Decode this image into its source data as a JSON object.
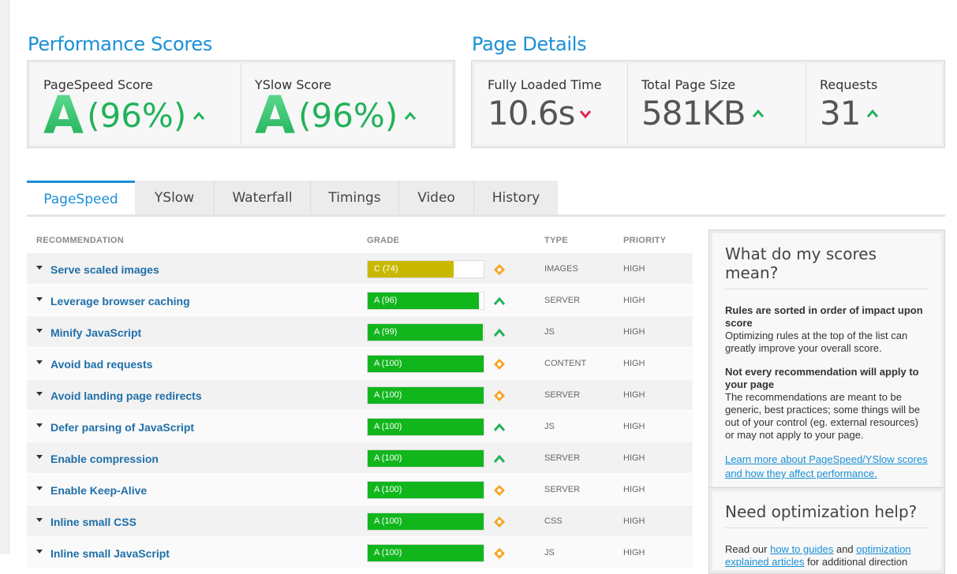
{
  "header": {
    "clipped_caption": "..."
  },
  "performance": {
    "title": "Performance Scores",
    "pagespeed": {
      "label": "PageSpeed Score",
      "grade": "A",
      "percent": "(96%)",
      "trend": "up"
    },
    "yslow": {
      "label": "YSlow Score",
      "grade": "A",
      "percent": "(96%)",
      "trend": "up"
    }
  },
  "details": {
    "title": "Page Details",
    "load_time": {
      "label": "Fully Loaded Time",
      "value": "10.6s",
      "trend": "down"
    },
    "page_size": {
      "label": "Total Page Size",
      "value": "581KB",
      "trend": "up"
    },
    "requests": {
      "label": "Requests",
      "value": "31",
      "trend": "up"
    }
  },
  "tabs": [
    {
      "label": "PageSpeed",
      "active": true
    },
    {
      "label": "YSlow",
      "active": false
    },
    {
      "label": "Waterfall",
      "active": false
    },
    {
      "label": "Timings",
      "active": false
    },
    {
      "label": "Video",
      "active": false
    },
    {
      "label": "History",
      "active": false
    }
  ],
  "table": {
    "headers": {
      "recommendation": "RECOMMENDATION",
      "grade": "GRADE",
      "type": "TYPE",
      "priority": "PRIORITY"
    },
    "rows": [
      {
        "name": "Serve scaled images",
        "grade": "C (74)",
        "score": 74,
        "color": "#c9b800",
        "trend": "neutral",
        "type": "IMAGES",
        "priority": "HIGH"
      },
      {
        "name": "Leverage browser caching",
        "grade": "A (96)",
        "score": 96,
        "color": "#11b61c",
        "trend": "up",
        "type": "SERVER",
        "priority": "HIGH"
      },
      {
        "name": "Minify JavaScript",
        "grade": "A (99)",
        "score": 99,
        "color": "#11b61c",
        "trend": "up",
        "type": "JS",
        "priority": "HIGH"
      },
      {
        "name": "Avoid bad requests",
        "grade": "A (100)",
        "score": 100,
        "color": "#11b61c",
        "trend": "neutral",
        "type": "CONTENT",
        "priority": "HIGH"
      },
      {
        "name": "Avoid landing page redirects",
        "grade": "A (100)",
        "score": 100,
        "color": "#11b61c",
        "trend": "neutral",
        "type": "SERVER",
        "priority": "HIGH"
      },
      {
        "name": "Defer parsing of JavaScript",
        "grade": "A (100)",
        "score": 100,
        "color": "#11b61c",
        "trend": "up",
        "type": "JS",
        "priority": "HIGH"
      },
      {
        "name": "Enable compression",
        "grade": "A (100)",
        "score": 100,
        "color": "#11b61c",
        "trend": "up",
        "type": "SERVER",
        "priority": "HIGH"
      },
      {
        "name": "Enable Keep-Alive",
        "grade": "A (100)",
        "score": 100,
        "color": "#11b61c",
        "trend": "neutral",
        "type": "SERVER",
        "priority": "HIGH"
      },
      {
        "name": "Inline small CSS",
        "grade": "A (100)",
        "score": 100,
        "color": "#11b61c",
        "trend": "neutral",
        "type": "CSS",
        "priority": "HIGH"
      },
      {
        "name": "Inline small JavaScript",
        "grade": "A (100)",
        "score": 100,
        "color": "#11b61c",
        "trend": "neutral",
        "type": "JS",
        "priority": "HIGH"
      }
    ]
  },
  "scores_help": {
    "title": "What do my scores mean?",
    "p1_bold": "Rules are sorted in order of impact upon score",
    "p1_text": "Optimizing rules at the top of the list can greatly improve your overall score.",
    "p2_bold": "Not every recommendation will apply to your page",
    "p2_text": "The recommendations are meant to be generic, best practices; some things will be out of your control (eg. external resources) or may not apply to your page.",
    "link": "Learn more about PageSpeed/YSlow scores and how they affect performance."
  },
  "optimization_help": {
    "title": "Need optimization help?",
    "text_prefix": "Read our",
    "link1": "how to guides",
    "text_mid": "and",
    "link2": "optimization explained articles",
    "text_suffix": "for additional direction"
  },
  "colors": {
    "accent": "#1a8fd6",
    "grade_a": "#11b61c",
    "grade_c": "#c9b800",
    "up": "#22b25a",
    "down": "#e2264d",
    "neutral": "#f5a623"
  }
}
